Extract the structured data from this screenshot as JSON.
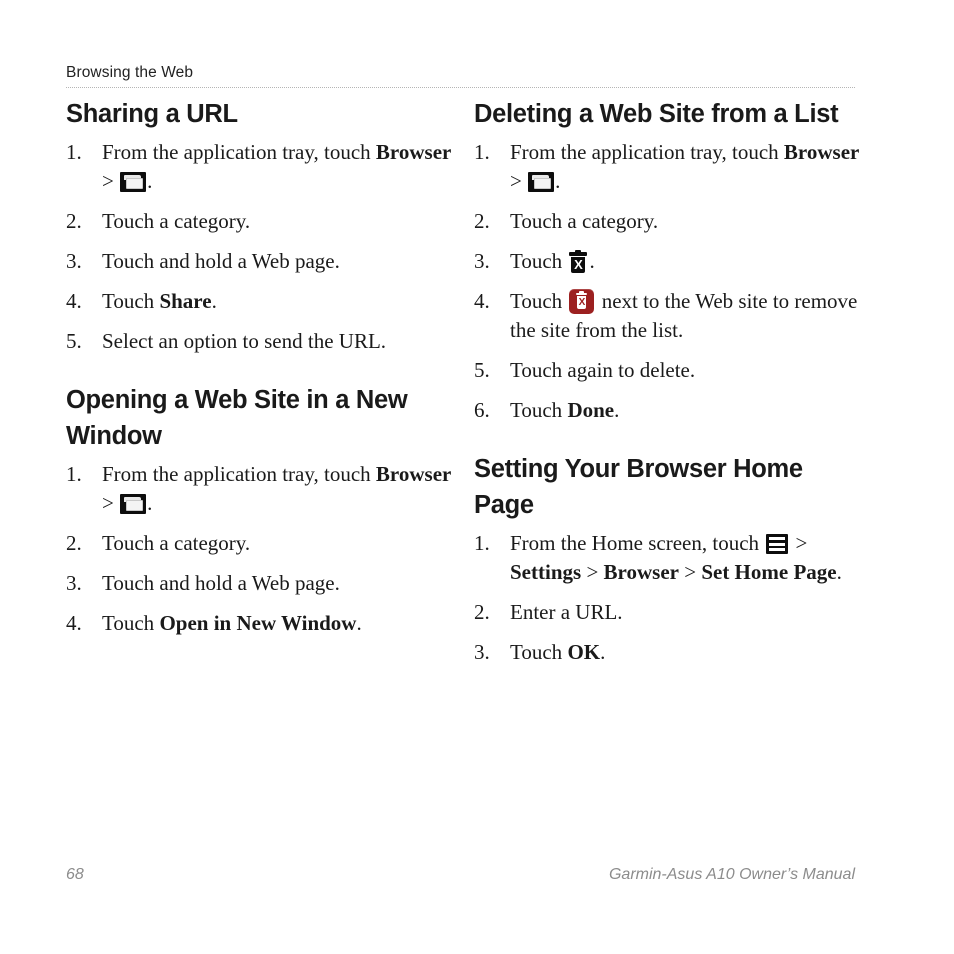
{
  "running_head": "Browsing the Web",
  "columns": {
    "left": [
      {
        "title": "Sharing a URL",
        "steps": [
          {
            "num": "1.",
            "pre": "From the application tray, touch ",
            "bold": "Browser",
            "sep": " > ",
            "icon": "folder-icon",
            "post": "."
          },
          {
            "num": "2.",
            "pre": "Touch a category."
          },
          {
            "num": "3.",
            "pre": "Touch and hold a Web page."
          },
          {
            "num": "4.",
            "pre": "Touch ",
            "bold": "Share",
            "post": "."
          },
          {
            "num": "5.",
            "pre": "Select an option to send the URL."
          }
        ]
      },
      {
        "title": "Opening a Web Site in a New Window",
        "steps": [
          {
            "num": "1.",
            "pre": "From the application tray, touch ",
            "bold": "Browser",
            "sep": " > ",
            "icon": "folder-icon",
            "post": "."
          },
          {
            "num": "2.",
            "pre": "Touch a category."
          },
          {
            "num": "3.",
            "pre": "Touch and hold a Web page."
          },
          {
            "num": "4.",
            "pre": "Touch ",
            "bold": "Open in New Window",
            "post": "."
          }
        ]
      }
    ],
    "right": [
      {
        "title": "Deleting a Web Site from a List",
        "steps": [
          {
            "num": "1.",
            "pre": "From the application tray, touch ",
            "bold": "Browser",
            "sep": " > ",
            "icon": "folder-icon",
            "post": "."
          },
          {
            "num": "2.",
            "pre": "Touch a category."
          },
          {
            "num": "3.",
            "pre": "Touch ",
            "icon": "trash-black-icon",
            "post": "."
          },
          {
            "num": "4.",
            "pre": "Touch ",
            "icon": "trash-red-icon",
            "post": " next to the Web site to remove the site from the list."
          },
          {
            "num": "5.",
            "pre": "Touch again to delete."
          },
          {
            "num": "6.",
            "pre": "Touch ",
            "bold": "Done",
            "post": "."
          }
        ]
      },
      {
        "title": "Setting Your Browser Home Page",
        "steps": [
          {
            "num": "1.",
            "pre": "From the Home screen, touch ",
            "icon": "menu-icon",
            "sep": " > ",
            "bold": "Settings",
            "sep2": " > ",
            "bold2": "Browser",
            "sep3": " > ",
            "bold3": "Set Home Page",
            "post": "."
          },
          {
            "num": "2.",
            "pre": "Enter a URL."
          },
          {
            "num": "3.",
            "pre": "Touch ",
            "bold": "OK",
            "post": "."
          }
        ]
      }
    ]
  },
  "footer": {
    "page_number": "68",
    "manual_title": "Garmin-Asus A10 Owner’s Manual"
  },
  "colors": {
    "text": "#1a1a1a",
    "rule": "#b5b5b5",
    "footer_text": "#8c8c8c",
    "icon_dark": "#0d0d0d",
    "icon_red": "#9c2020"
  }
}
